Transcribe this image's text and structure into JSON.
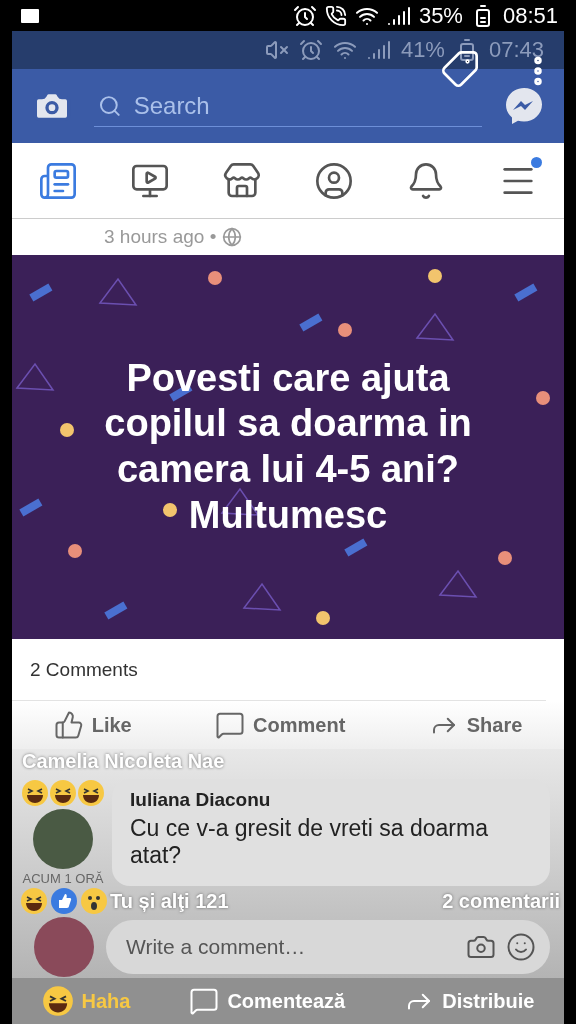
{
  "phone_status": {
    "battery": "35%",
    "time": "08:51"
  },
  "inner_status": {
    "battery": "41%",
    "time": "07:43"
  },
  "search": {
    "placeholder": "Search"
  },
  "nav_tabs": [
    {
      "kind": "feed",
      "selected": true,
      "badge": false
    },
    {
      "kind": "video",
      "selected": false,
      "badge": false
    },
    {
      "kind": "marketplace",
      "selected": false,
      "badge": false
    },
    {
      "kind": "profile",
      "selected": false,
      "badge": false
    },
    {
      "kind": "notifications",
      "selected": false,
      "badge": false
    },
    {
      "kind": "menu",
      "selected": false,
      "badge": true
    }
  ],
  "post": {
    "timestamp": "3 hours ago •",
    "text": "Povesti care ajuta copilul sa doarma in camera lui 4-5 ani? Multumesc",
    "comments_count": "2 Comments",
    "actions": [
      {
        "kind": "like",
        "label": "Like"
      },
      {
        "kind": "comment",
        "label": "Comment"
      },
      {
        "kind": "share",
        "label": "Share"
      }
    ]
  },
  "overlay": {
    "author": "Camelia Nicoleta Nae",
    "time": "ACUM 1 ORĂ",
    "reactions_summary": "Tu și alţi 121",
    "comments_link": "2 comentarii",
    "actions": [
      {
        "kind": "haha",
        "label": "Haha",
        "selected": true
      },
      {
        "kind": "comment",
        "label": "Comentează",
        "selected": false
      },
      {
        "kind": "share",
        "label": "Distribuie",
        "selected": false
      }
    ]
  },
  "comment": {
    "author": "Iuliana Diaconu",
    "text": "Cu ce v-a gresit de vreti sa doarma atat?"
  },
  "composer": {
    "placeholder": "Write a comment…"
  }
}
